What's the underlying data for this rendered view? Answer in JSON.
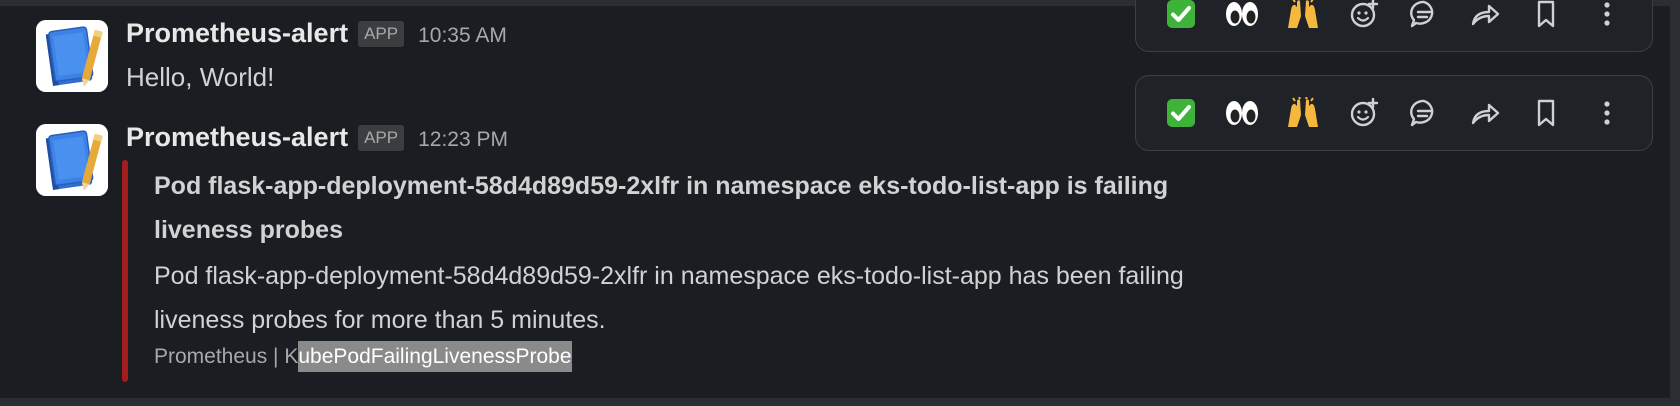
{
  "colors": {
    "background": "#1a1d21",
    "attachment_bar": "#a41d1d",
    "toolbar_bg": "#1f2226",
    "text": "#d1d2d3",
    "muted": "#a7a8aa"
  },
  "messages": [
    {
      "sender": "Prometheus-alert",
      "badge": "APP",
      "time": "10:35 AM",
      "text": "Hello, World!",
      "avatar_icon": "notebook-icon"
    },
    {
      "sender": "Prometheus-alert",
      "badge": "APP",
      "time": "12:23 PM",
      "avatar_icon": "notebook-icon",
      "attachment": {
        "title": "Pod flask-app-deployment-58d4d89d59-2xlfr in namespace eks-todo-list-app is failing liveness probes",
        "body": "Pod flask-app-deployment-58d4d89d59-2xlfr in namespace eks-todo-list-app has been failing liveness probes for more than 5 minutes.",
        "footer_prefix": "Prometheus | K",
        "footer_highlight": "ubePodFailingLivenessProbe"
      }
    }
  ],
  "toolbar_icons": [
    "white-check-mark-icon",
    "eyes-icon",
    "raised-hands-icon",
    "add-reaction-icon",
    "reply-in-thread-icon",
    "share-icon",
    "save-bookmark-icon",
    "more-actions-icon"
  ]
}
